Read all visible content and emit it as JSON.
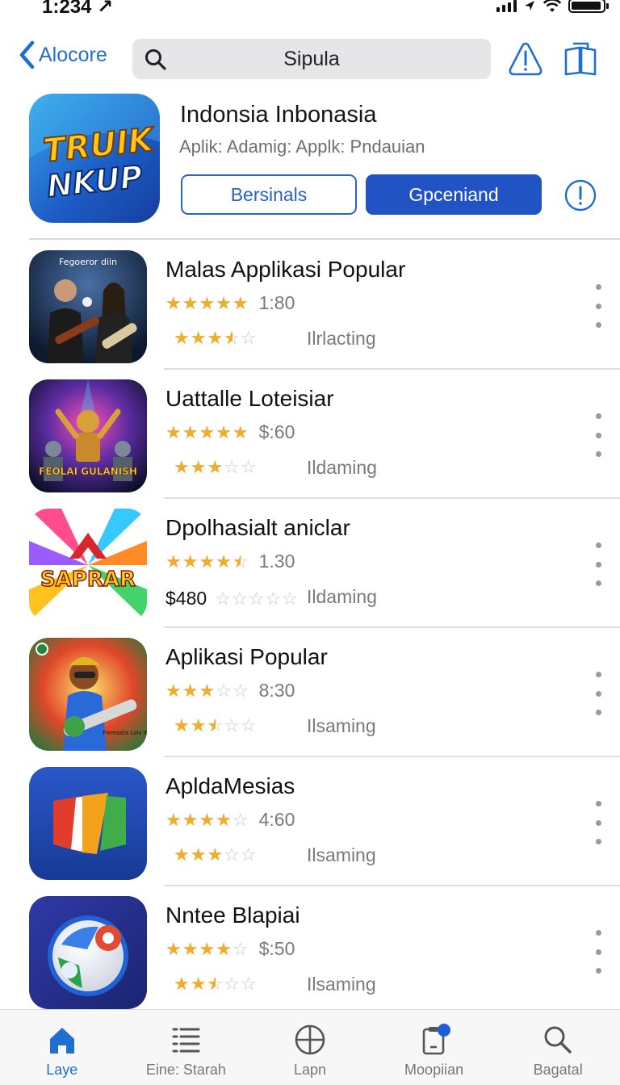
{
  "status_bar": {
    "time": "1:234 ↗",
    "battery_level": 0.95
  },
  "nav": {
    "back_label": "Alocore",
    "search_value": "Sipula"
  },
  "featured": {
    "icon_text_line1": "TRUIK",
    "icon_text_line2": "NKUP",
    "title": "Indonsia Inbonasia",
    "subtitle": "Aplik: Adamig: Applk: Pndauian",
    "secondary_button": "Bersinals",
    "primary_button": "Gpceniand"
  },
  "apps": [
    {
      "title": "Malas Applikasi Popular",
      "rating1": 5,
      "line1": "1:80",
      "price": "",
      "rating2": 3.5,
      "status": "Ilrlacting",
      "icon_text": "Fegoeror diin"
    },
    {
      "title": "Uattalle Loteisiar",
      "rating1": 5,
      "line1": "$:60",
      "price": "",
      "rating2": 3,
      "status": "Ildaming",
      "icon_text": "FEOLAI GULANISH"
    },
    {
      "title": "Dpolhasialt aniclar",
      "rating1": 4.5,
      "line1": "1.30",
      "price": "$480",
      "rating2": 0,
      "status": "Ildaming",
      "icon_text": "SAPRAR"
    },
    {
      "title": "Aplikasi Popular",
      "rating1": 3,
      "line1": "8:30",
      "price": "",
      "rating2": 2.5,
      "status": "Ilsaming",
      "icon_text": "Flemosta Lolx Ital"
    },
    {
      "title": "ApldaMesias",
      "rating1": 4,
      "line1": "4:60",
      "price": "",
      "rating2": 3,
      "status": "Ilsaming",
      "icon_text": ""
    },
    {
      "title": "Nntee Blapiai",
      "rating1": 4,
      "line1": "$:50",
      "price": "",
      "rating2": 2.5,
      "status": "Ilsaming",
      "icon_text": ""
    }
  ],
  "tabs": [
    {
      "label": "Laye",
      "icon": "home-icon",
      "active": true
    },
    {
      "label": "Eine: Starah",
      "icon": "list-icon",
      "active": false
    },
    {
      "label": "Lapn",
      "icon": "globe-icon",
      "active": false
    },
    {
      "label": "Moopiian",
      "icon": "clipboard-icon",
      "active": false
    },
    {
      "label": "Bagatal",
      "icon": "search-icon",
      "active": false
    }
  ],
  "colors": {
    "accent": "#2153c4",
    "link": "#1f6fd1",
    "star": "#f0ad2a"
  }
}
